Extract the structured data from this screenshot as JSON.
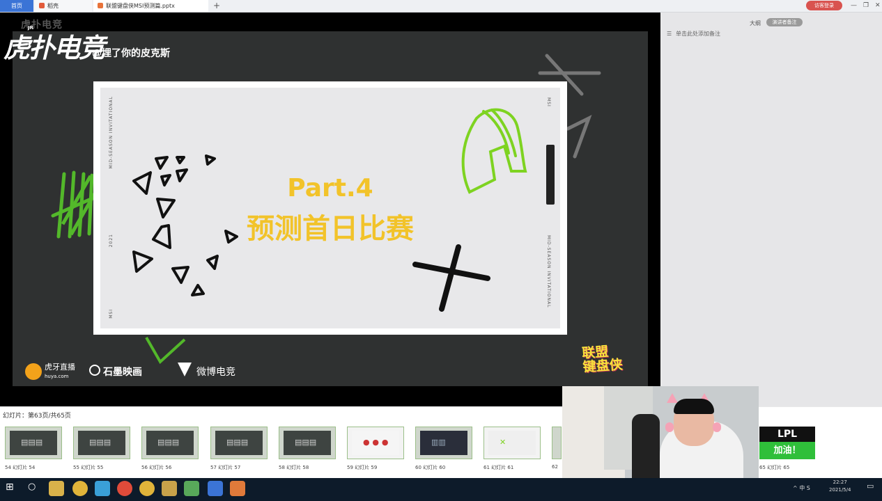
{
  "tabs": [
    {
      "label": "首页"
    },
    {
      "label": "稻壳"
    },
    {
      "label": "联盟键盘侠MSI预测篇.pptx"
    }
  ],
  "toolbar": {
    "new_tab": "+",
    "login": "访客登录",
    "win_min": "—",
    "win_max": "❐",
    "win_close": "✕"
  },
  "overlay": {
    "logo": "虎扑电竞",
    "logo_jr": "JR",
    "handle": "@埋了你的皮克斯",
    "top_grey": "虎扑电竞",
    "sponsors": [
      {
        "label": "虎牙直播",
        "sub": "huya.com"
      },
      {
        "label": "石墨映画"
      },
      {
        "label": "微博电竞"
      }
    ],
    "show_logo": "联盟\n键盘侠"
  },
  "slide": {
    "title": "Part.4",
    "subtitle": "预测首日比赛",
    "side_left_top": "MID-SEASON INVITATIONAL",
    "side_left_year": "2021",
    "side_left_bottom": "MSI",
    "side_right_top": "MSI",
    "side_right_bottom": "MID-SEASON INVITATIONAL",
    "accent_yellow": "#f2c32a",
    "accent_green": "#7ed321"
  },
  "notes": {
    "outline": "大纲",
    "presenter": "演讲者备注",
    "placeholder": "单击此处添加备注"
  },
  "strip": {
    "info": "幻灯片：第63页/共65页",
    "thumbs": [
      {
        "num": "54",
        "label": "幻灯片 54"
      },
      {
        "num": "55",
        "label": "幻灯片 55"
      },
      {
        "num": "56",
        "label": "幻灯片 56"
      },
      {
        "num": "57",
        "label": "幻灯片 57"
      },
      {
        "num": "58",
        "label": "幻灯片 58"
      },
      {
        "num": "59",
        "label": "幻灯片 59"
      },
      {
        "num": "60",
        "label": "幻灯片 60"
      },
      {
        "num": "61",
        "label": "幻灯片 61"
      },
      {
        "num": "62",
        "label": "62"
      },
      {
        "num": "65",
        "label": "幻灯片 65"
      }
    ]
  },
  "lpl_banner": {
    "line1": "LPL",
    "line2": "加油！"
  },
  "taskbar": {
    "tray": "^  中  S",
    "time": "22:27",
    "date": "2021/5/4"
  }
}
